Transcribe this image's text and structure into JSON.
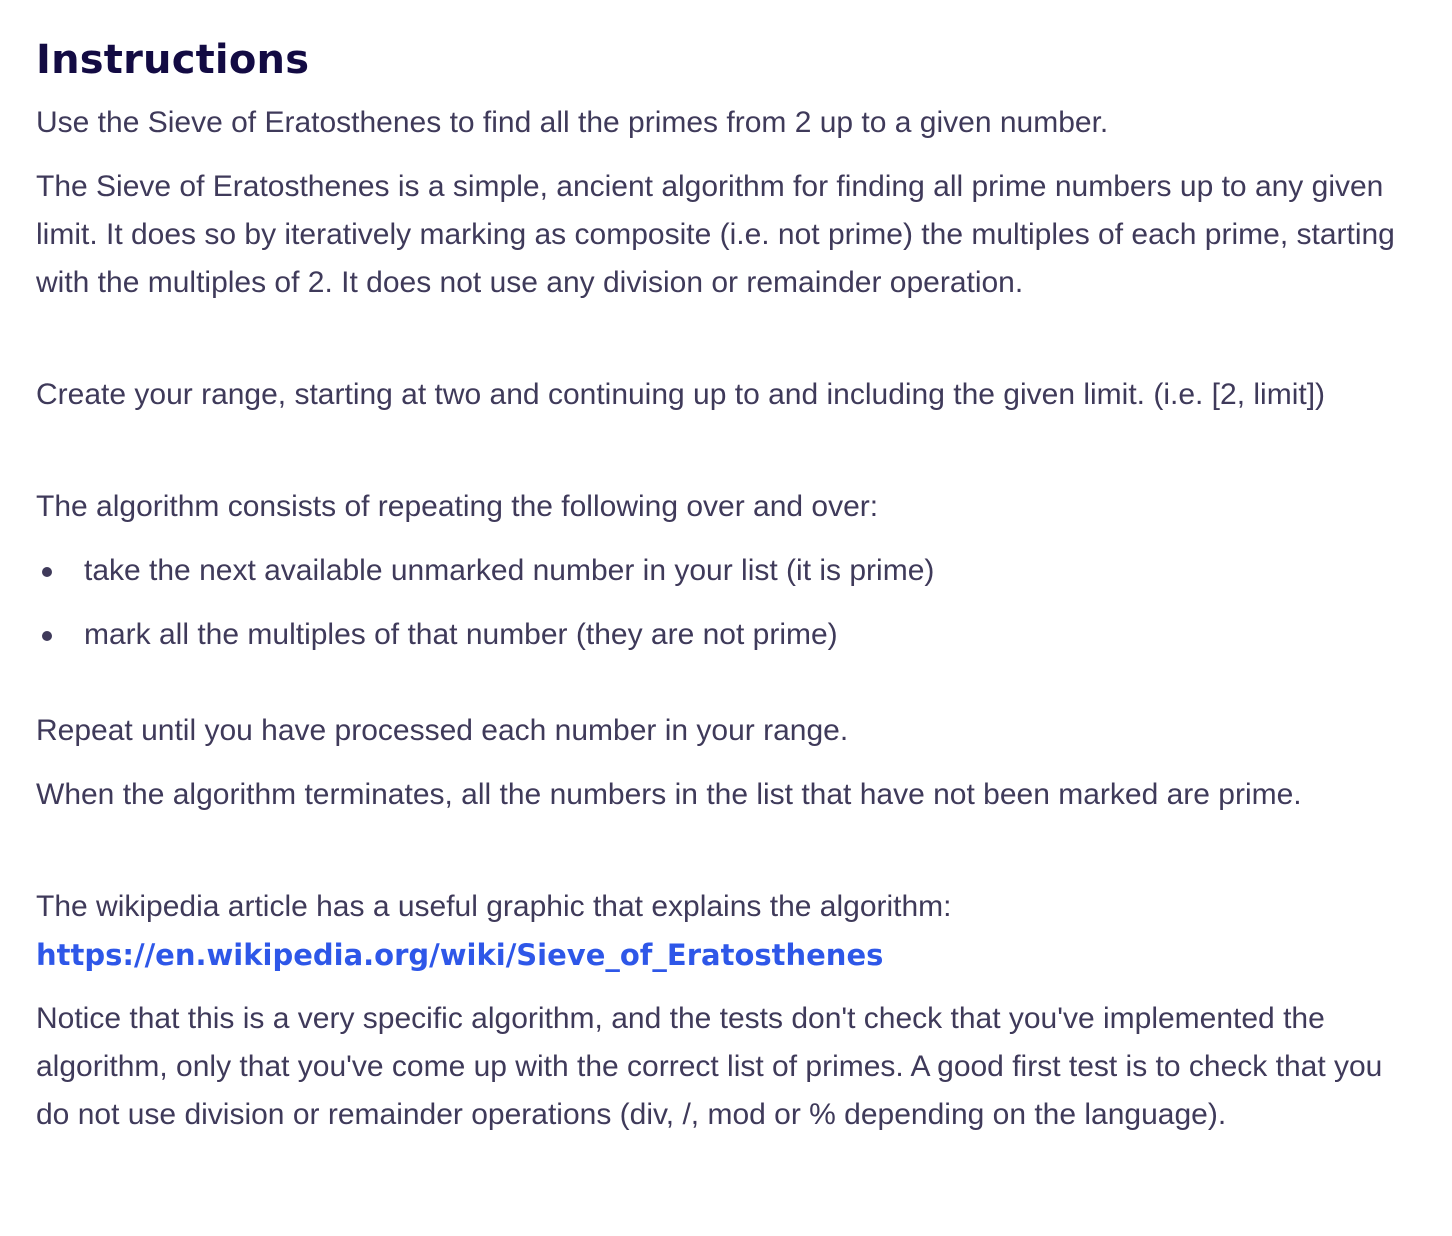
{
  "title": "Instructions",
  "paragraphs": {
    "p1": "Use the Sieve of Eratosthenes to find all the primes from 2 up to a given number.",
    "p2": "The Sieve of Eratosthenes is a simple, ancient algorithm for finding all prime numbers up to any given limit. It does so by iteratively marking as composite (i.e. not prime) the multiples of each prime, starting with the multiples of 2. It does not use any division or remainder operation.",
    "p3": "Create your range, starting at two and continuing up to and including the given limit. (i.e. [2, limit])",
    "p4": "The algorithm consists of repeating the following over and over:",
    "p5": "Repeat until you have processed each number in your range.",
    "p6": "When the algorithm terminates, all the numbers in the list that have not been marked are prime.",
    "p7": "The wikipedia article has a useful graphic that explains the algorithm:",
    "p8": "Notice that this is a very specific algorithm, and the tests don't check that you've implemented the algorithm, only that you've come up with the correct list of primes. A good first test is to check that you do not use division or remainder operations (div, /, mod or % depending on the language)."
  },
  "bullets": [
    "take the next available unmarked number in your list (it is prime)",
    "mark all the multiples of that number (they are not prime)"
  ],
  "link": {
    "text": "https://en.wikipedia.org/wiki/Sieve_of_Eratosthenes",
    "href": "https://en.wikipedia.org/wiki/Sieve_of_Eratosthenes"
  },
  "colors": {
    "heading": "#130b43",
    "text": "#3f3a5a",
    "link": "#2e57e8",
    "background": "#ffffff"
  }
}
